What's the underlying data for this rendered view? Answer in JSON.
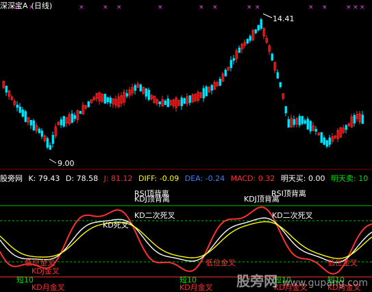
{
  "price_header": {
    "title": "深深宝A",
    "period": "(日线)"
  },
  "price_chart": {
    "high_label": "14.41",
    "low_label": "9.00"
  },
  "indicator_header": {
    "name": "股旁网",
    "k": "K: 79.43",
    "d": "D: 78.58",
    "j": "J: 81.12",
    "diff": "DIFF: -0.09",
    "dea": "DEA: -0.24",
    "macd": "MACD: 0.32",
    "buy_tomorrow": "明天买: 0.00",
    "sell_tomorrow": "明天卖: 10"
  },
  "signals": {
    "rsi_top_div_1": "RSI顶背离",
    "kdj_top_div_1": "KDJ顶背离",
    "kd_second_death_1": "KD二次死叉",
    "kd_death_cross": "KD死叉",
    "rsi_top_div_2": "RSI顶背离",
    "kdj_top_div_2": "KDJ顶背离",
    "kd_second_death_2": "KD二次死叉",
    "low_golden_1": "低位金叉",
    "kdj_golden_1": "KDJ金叉",
    "short10_1": "短10",
    "kd_month_gold_1": "KD月金叉",
    "short10_2": "短10",
    "kd_month_gold_2": "KD月金叉",
    "low_golden_2": "低位金叉",
    "short10_3": "短10",
    "kd_month_gold_3": "KD月金叉",
    "low_golden_3": "低位金叉",
    "short10_4": "短10",
    "kd_month_gold_4": "KD月金叉"
  },
  "watermark": {
    "cn": "股旁网",
    "url": "www.gupang.com"
  },
  "colors": {
    "up": "#ff3030",
    "down": "#00e5ff",
    "k_line": "#ffffff",
    "d_line": "#ffff00",
    "j_line": "#ff3030",
    "band_green": "#00c000",
    "marker": "#ff40ff"
  }
}
